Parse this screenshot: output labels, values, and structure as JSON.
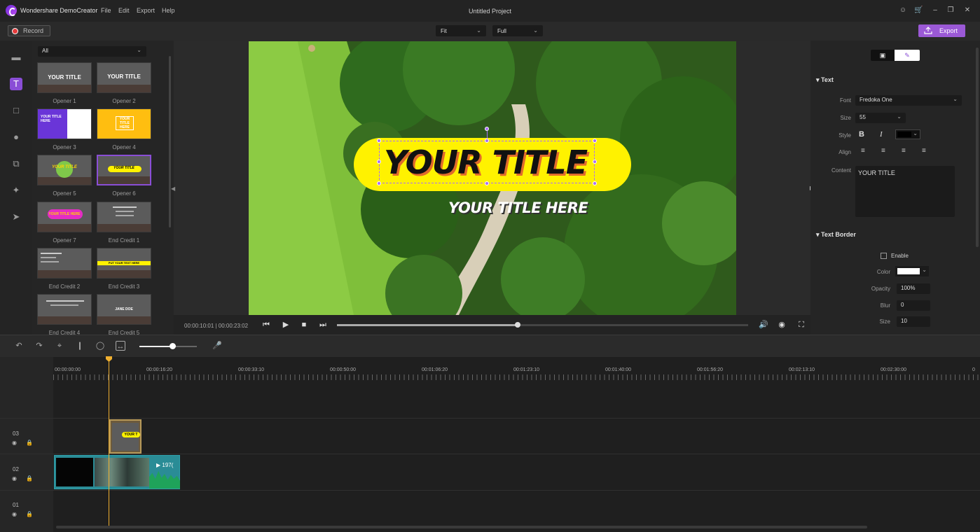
{
  "app": {
    "name": "Wondershare DemoCreator",
    "project_title": "Untitled Project"
  },
  "menu": [
    "File",
    "Edit",
    "Export",
    "Help"
  ],
  "toolbar": {
    "record_label": "Record",
    "fit_select": "Fit",
    "quality_select": "Full",
    "export_label": "Export"
  },
  "library": {
    "filter": "All",
    "items": [
      {
        "label": "Opener 1",
        "thumb_text": "YOUR TITLE"
      },
      {
        "label": "Opener 2",
        "thumb_text": "YOUR TITLE"
      },
      {
        "label": "Opener 3",
        "thumb_text": "YOUR TITLE HERE"
      },
      {
        "label": "Opener 4",
        "thumb_text": "YOUR TITLE HERE"
      },
      {
        "label": "Opener 5",
        "thumb_text": "YOUR TITLE"
      },
      {
        "label": "Opener 6",
        "thumb_text": "YOUR TITLE"
      },
      {
        "label": "Opener 7",
        "thumb_text": "YOUR TITLE HERE"
      },
      {
        "label": "End Credit 1",
        "thumb_text": ""
      },
      {
        "label": "End Credit 2",
        "thumb_text": ""
      },
      {
        "label": "End Credit 3",
        "thumb_text": "PUT YOUR TEXT HERE"
      },
      {
        "label": "End Credit 4",
        "thumb_text": ""
      },
      {
        "label": "End Credit 5",
        "thumb_text": "JANE DOE"
      }
    ]
  },
  "preview": {
    "title": "YOUR TITLE",
    "subtitle": "YOUR TITLE HERE",
    "timecode": "00:00:10:01 | 00:00:23:02",
    "progress": 0.44
  },
  "properties": {
    "text_section": "Text",
    "font_label": "Font",
    "font_value": "Fredoka One",
    "size_label": "Size",
    "size_value": "55",
    "style_label": "Style",
    "align_label": "Align",
    "content_label": "Content",
    "content_value": "YOUR TITLE",
    "border_section": "Text Border",
    "enable_label": "Enable",
    "color_label": "Color",
    "opacity_label": "Opacity",
    "opacity_value": "100%",
    "blur_label": "Blur",
    "blur_value": "0",
    "bsize_label": "Size",
    "bsize_value": "10",
    "text_color": "#000000",
    "border_color": "#ffffff"
  },
  "timeline": {
    "ruler": [
      "00:00:00:00",
      "00:00:16:20",
      "00:00:33:10",
      "00:00:50:00",
      "00:01:06:20",
      "00:01:23:10",
      "00:01:40:00",
      "00:01:56:20",
      "00:02:13:10",
      "00:02:30:00",
      "0"
    ],
    "tracks": [
      "03",
      "02",
      "01"
    ],
    "title_clip": "YOUR T",
    "video_clip_badge": "197("
  }
}
